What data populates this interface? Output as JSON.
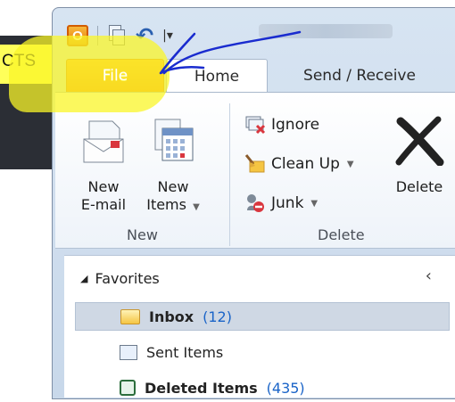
{
  "background": {
    "left_text": "CTS"
  },
  "quick_access": {
    "customize_glyph": "|▾"
  },
  "tabs": [
    {
      "label": "File"
    },
    {
      "label": "Home"
    },
    {
      "label": "Send / Receive"
    }
  ],
  "ribbon": {
    "groups": [
      {
        "label": "New"
      },
      {
        "label": "Delete"
      }
    ],
    "new_email": {
      "line1": "New",
      "line2": "E-mail"
    },
    "new_items": {
      "line1": "New",
      "line2": "Items"
    },
    "ignore": "Ignore",
    "clean_up": "Clean Up",
    "junk": "Junk",
    "delete": "Delete"
  },
  "nav": {
    "favorites": "Favorites",
    "items": [
      {
        "label": "Inbox",
        "count": "(12)"
      },
      {
        "label": "Sent Items",
        "count": ""
      },
      {
        "label": "Deleted Items",
        "count": "(435)"
      }
    ]
  },
  "colors": {
    "file_tab": "#f4860c",
    "highlighter": "#faf528",
    "annotation_ink": "#1a2ccf"
  }
}
